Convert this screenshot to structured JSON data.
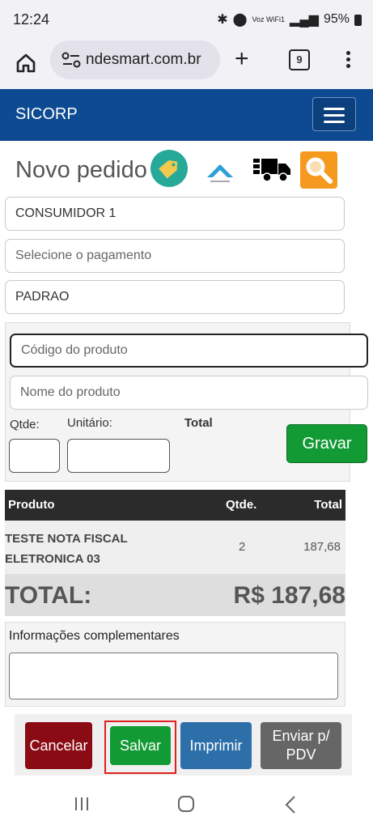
{
  "status_bar": {
    "time": "12:24",
    "battery": "95%",
    "network": "Voz WiFi1"
  },
  "browser": {
    "url": "ndesmart.com.br",
    "tab_count": "9"
  },
  "app": {
    "title": "SICORP"
  },
  "page": {
    "title": "Novo pedido"
  },
  "order": {
    "customer": "CONSUMIDOR 1",
    "payment_placeholder": "Selecione o pagamento",
    "price_table": "PADRAO"
  },
  "product_entry": {
    "code_placeholder": "Código do produto",
    "name_placeholder": "Nome do produto",
    "qty_label": "Qtde:",
    "unit_label": "Unitário:",
    "total_label": "Total",
    "save_button": "Gravar"
  },
  "items_table": {
    "columns": [
      "Produto",
      "Qtde.",
      "Total"
    ],
    "rows": [
      {
        "product": "TESTE NOTA FISCAL ELETRONICA 03",
        "qty": "2",
        "total": "187,68"
      }
    ]
  },
  "totals": {
    "label": "TOTAL:",
    "value": "R$ 187,68"
  },
  "complementary": {
    "label": "Informações complementares"
  },
  "actions": {
    "cancel": "Cancelar",
    "save": "Salvar",
    "print": "Imprimir",
    "send": "Enviar p/ PDV"
  },
  "colors": {
    "header": "#0d4a91",
    "save_green": "#129a34",
    "cancel_red": "#8a0b14",
    "print_blue": "#2d6fa8",
    "highlight_red": "#e02020"
  }
}
